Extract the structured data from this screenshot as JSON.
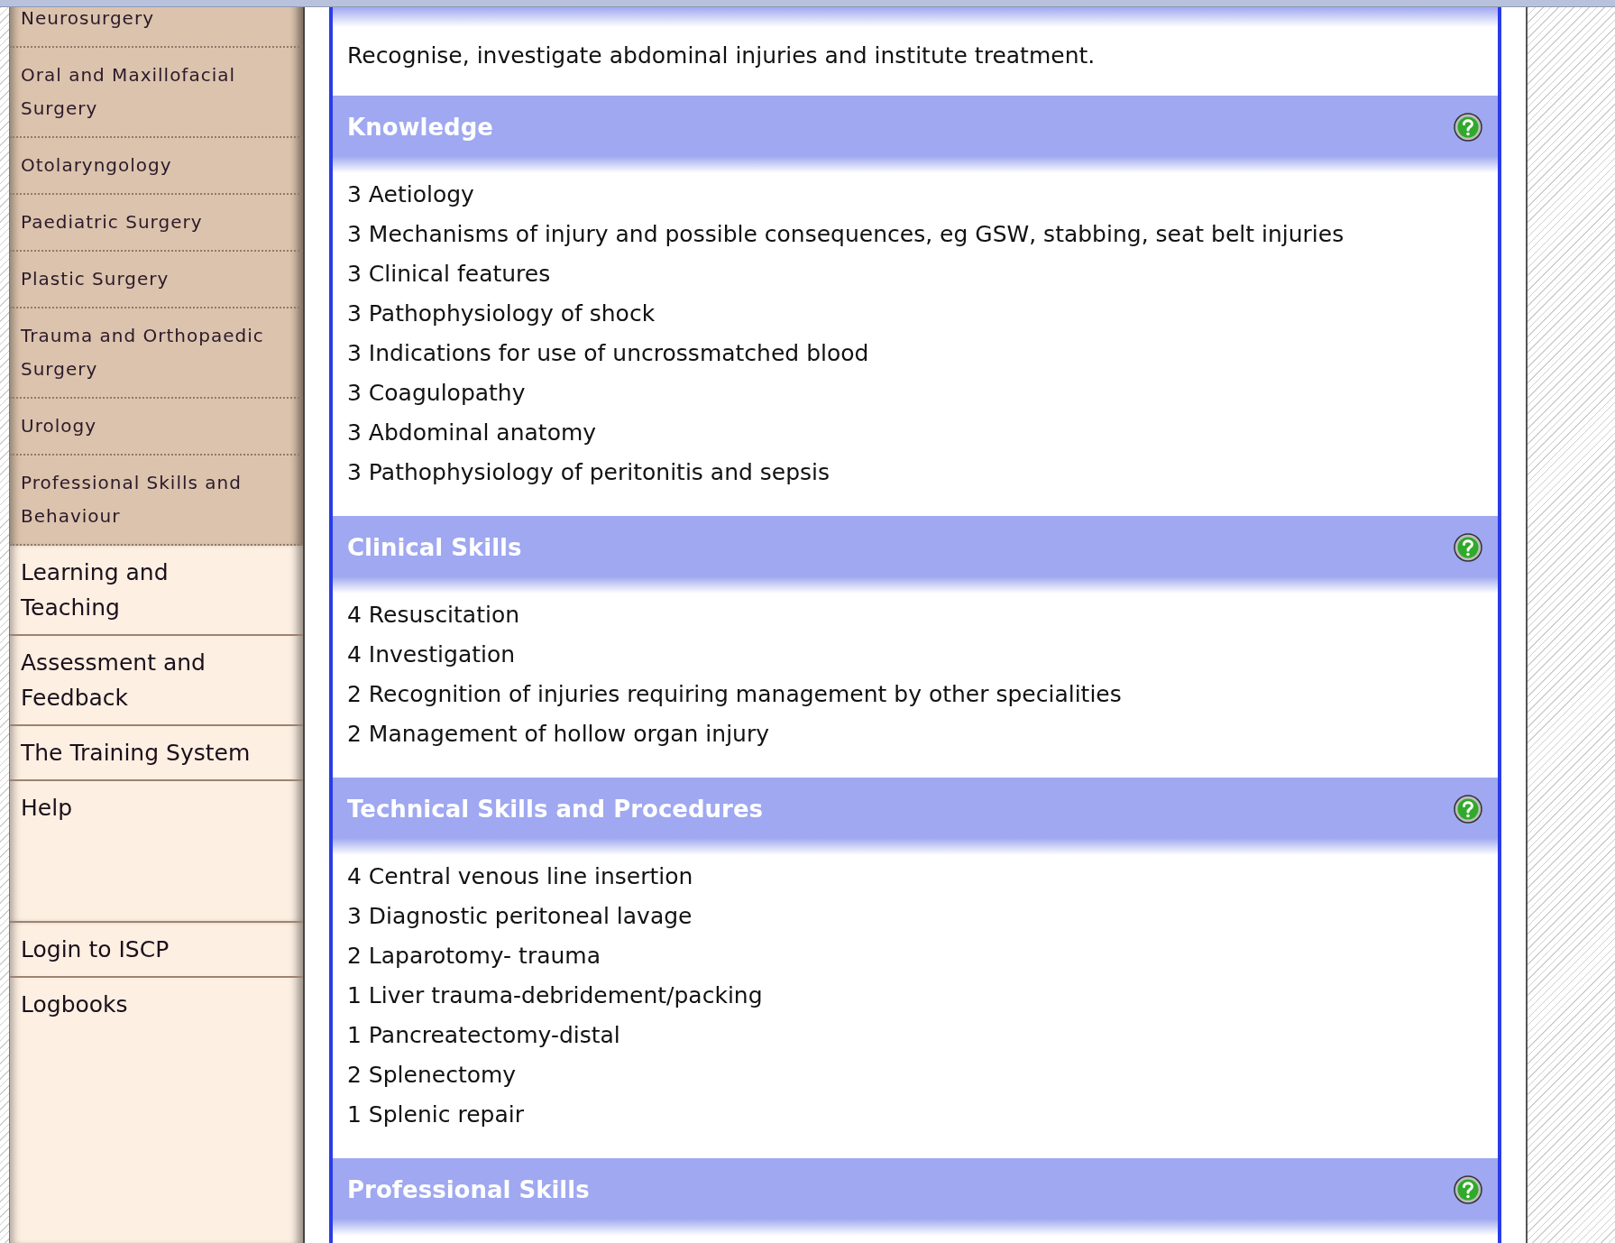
{
  "sidebar": {
    "groups": [
      {
        "kind": "sub",
        "items": [
          "Neurosurgery",
          "Oral and Maxillofacial Surgery",
          "Otolaryngology",
          "Paediatric Surgery",
          "Plastic Surgery",
          "Trauma and Orthopaedic Surgery",
          "Urology",
          "Professional Skills and Behaviour"
        ]
      },
      {
        "kind": "main",
        "items": [
          "Learning and Teaching",
          "Assessment and Feedback",
          "The Training System",
          "Help"
        ]
      },
      {
        "kind": "main",
        "items": [
          "Login to ISCP",
          "Logbooks"
        ]
      }
    ]
  },
  "content": {
    "description": "Recognise, investigate abdominal injuries and institute treatment.",
    "sections": [
      {
        "title": "Knowledge",
        "items": [
          "3 Aetiology",
          "3 Mechanisms of injury and possible consequences, eg GSW, stabbing, seat belt injuries",
          "3 Clinical features",
          "3 Pathophysiology of shock",
          "3 Indications for use of uncrossmatched blood",
          "3 Coagulopathy",
          "3 Abdominal anatomy",
          "3 Pathophysiology of peritonitis and sepsis"
        ]
      },
      {
        "title": "Clinical Skills",
        "items": [
          "4 Resuscitation",
          "4 Investigation",
          "2 Recognition of injuries requiring management by other specialities",
          "2 Management of hollow organ injury"
        ]
      },
      {
        "title": "Technical Skills and Procedures",
        "items": [
          "4 Central venous line insertion",
          "3 Diagnostic peritoneal lavage",
          "2 Laparotomy- trauma",
          "1 Liver trauma-debridement/packing",
          "1 Pancreatectomy-distal",
          "2 Splenectomy",
          "1 Splenic repair"
        ]
      },
      {
        "title": "Professional Skills"
      }
    ]
  }
}
